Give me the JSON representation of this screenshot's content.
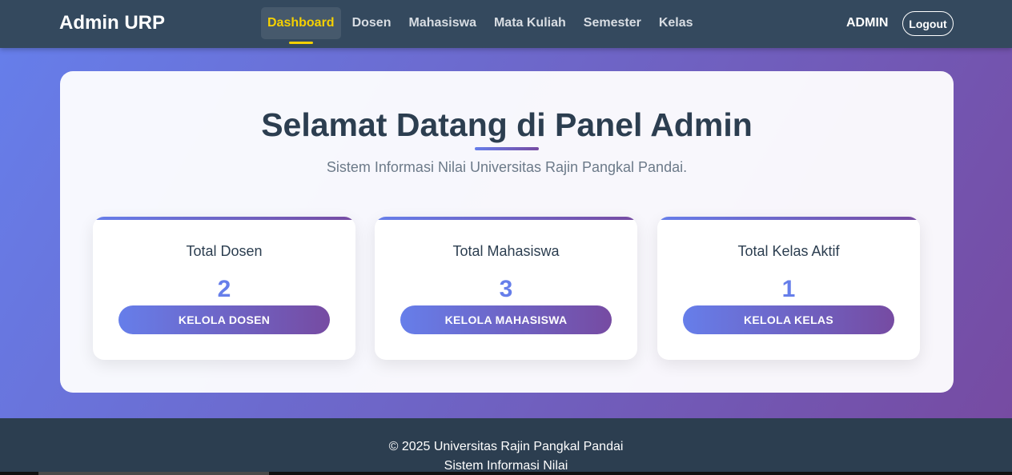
{
  "navbar": {
    "brand": "Admin URP",
    "links": [
      {
        "label": "Dashboard",
        "active": true
      },
      {
        "label": "Dosen"
      },
      {
        "label": "Mahasiswa"
      },
      {
        "label": "Mata Kuliah"
      },
      {
        "label": "Semester"
      },
      {
        "label": "Kelas"
      }
    ],
    "user": "ADMIN",
    "logout_label": "Logout"
  },
  "panel": {
    "title": "Selamat Datang di Panel Admin",
    "subtitle": "Sistem Informasi Nilai Universitas Rajin Pangkal Pandai."
  },
  "stats": [
    {
      "label": "Total Dosen",
      "value": "2",
      "button": "KELOLA DOSEN"
    },
    {
      "label": "Total Mahasiswa",
      "value": "3",
      "button": "KELOLA MAHASISWA"
    },
    {
      "label": "Total Kelas Aktif",
      "value": "1",
      "button": "KELOLA KELAS"
    }
  ],
  "footer": {
    "copyright": "© 2025 Universitas Rajin Pangkal Pandai",
    "tagline": "Sistem Informasi Nilai"
  },
  "colors": {
    "navbar": "#34495e",
    "accent_active": "#f5d000",
    "gradient_start": "#667eea",
    "gradient_end": "#764ba2",
    "footer": "#2c3e50"
  }
}
